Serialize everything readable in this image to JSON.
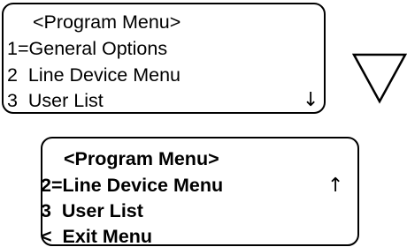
{
  "screen_before": {
    "title": "<Program Menu>",
    "lines": [
      "1=General Options",
      "2  Line Device Menu",
      "3  User List"
    ],
    "scroll_indicator": "↓"
  },
  "down_key": {
    "icon": "down-triangle-icon"
  },
  "screen_after": {
    "title": "<Program Menu>",
    "lines": [
      "2=Line Device Menu",
      "3  User List",
      "<  Exit Menu"
    ],
    "scroll_indicator": "↑"
  }
}
